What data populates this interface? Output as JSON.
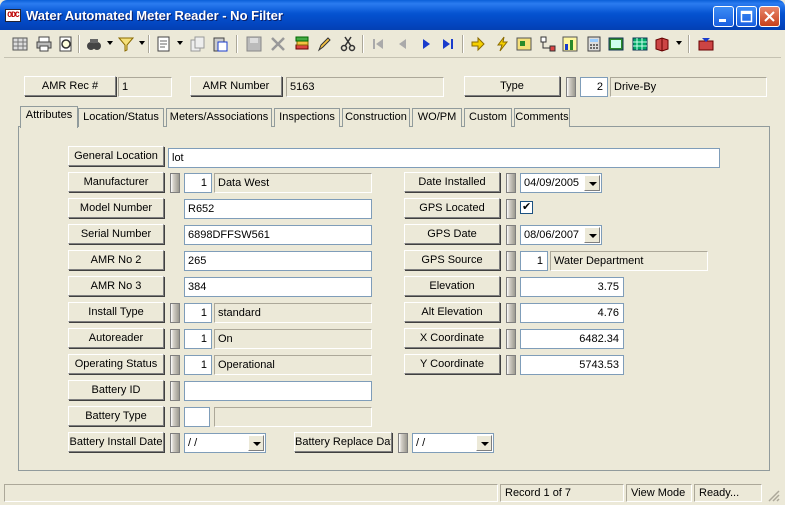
{
  "window": {
    "title": "Water Automated Meter Reader - No Filter",
    "app_icon_text": "ODC"
  },
  "header": {
    "amr_rec_label": "AMR Rec #",
    "amr_rec_value": "1",
    "amr_number_label": "AMR Number",
    "amr_number_value": "5163",
    "type_label": "Type",
    "type_code": "2",
    "type_value": "Drive-By"
  },
  "tabs": [
    "Attributes",
    "Location/Status",
    "Meters/Associations",
    "Inspections",
    "Construction",
    "WO/PM",
    "Custom",
    "Comments"
  ],
  "active_tab": "Attributes",
  "form": {
    "general_location": {
      "label": "General Location",
      "value": "lot"
    },
    "manufacturer": {
      "label": "Manufacturer",
      "code": "1",
      "value": "Data West"
    },
    "model_number": {
      "label": "Model Number",
      "value": "R652"
    },
    "serial_number": {
      "label": "Serial Number",
      "value": "6898DFFSW561"
    },
    "amr_no_2": {
      "label": "AMR No 2",
      "value": "265"
    },
    "amr_no_3": {
      "label": "AMR No 3",
      "value": "384"
    },
    "install_type": {
      "label": "Install Type",
      "code": "1",
      "value": "standard"
    },
    "autoreader": {
      "label": "Autoreader",
      "code": "1",
      "value": "On"
    },
    "operating_status": {
      "label": "Operating Status",
      "code": "1",
      "value": "Operational"
    },
    "battery_id": {
      "label": "Battery ID",
      "value": ""
    },
    "battery_type": {
      "label": "Battery Type",
      "code": "",
      "value": ""
    },
    "battery_install_date": {
      "label": "Battery Install Date",
      "value": " /  /"
    },
    "battery_replace_date": {
      "label": "Battery Replace Date",
      "value": " /  /"
    },
    "date_installed": {
      "label": "Date Installed",
      "value": "04/09/2005"
    },
    "gps_located": {
      "label": "GPS Located",
      "checked": true,
      "check_mark": "✔"
    },
    "gps_date": {
      "label": "GPS Date",
      "value": "08/06/2007"
    },
    "gps_source": {
      "label": "GPS Source",
      "code": "1",
      "value": "Water Department"
    },
    "elevation": {
      "label": "Elevation",
      "value": "3.75"
    },
    "alt_elevation": {
      "label": "Alt Elevation",
      "value": "4.76"
    },
    "x_coordinate": {
      "label": "X Coordinate",
      "value": "6482.34"
    },
    "y_coordinate": {
      "label": "Y Coordinate",
      "value": "5743.53"
    }
  },
  "status": {
    "record": "Record 1 of 7",
    "mode": "View Mode",
    "state": "Ready..."
  },
  "toolbar": {
    "icons": [
      "grid-icon",
      "print-icon",
      "print-preview-icon",
      "find-icon",
      "filter-icon",
      "new-record-icon",
      "copy-record-icon",
      "paste-icon",
      "save-icon",
      "delete-icon",
      "stack-icon",
      "edit-icon",
      "cut-icon",
      "first-record-icon",
      "previous-record-icon",
      "next-record-icon",
      "last-record-icon",
      "jump-icon",
      "lightning-icon",
      "map-icon",
      "tree-icon",
      "chart-icon",
      "calculator-icon",
      "spreadsheet-icon",
      "book-icon",
      "exit-icon"
    ]
  },
  "colors": {
    "titlebar": "#0553d1",
    "face": "#ece9d8",
    "field_border": "#7f9db9",
    "navigation_blue": "#1a3ccc"
  }
}
